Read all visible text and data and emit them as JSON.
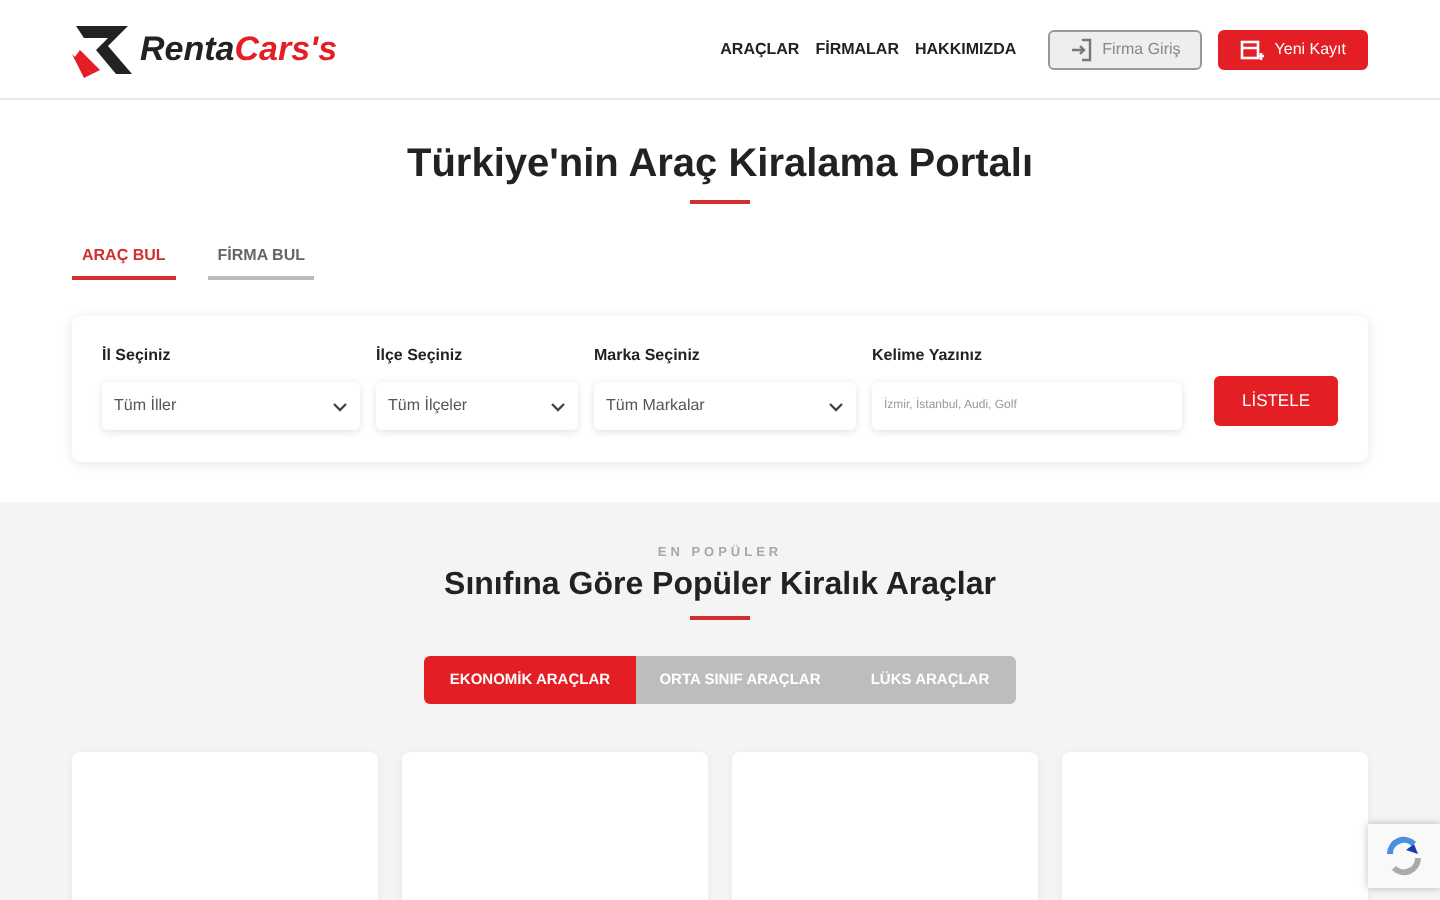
{
  "brand": {
    "name_part_1": "Renta",
    "name_part_2": "Cars's"
  },
  "nav": [
    {
      "label": "ARAÇLAR"
    },
    {
      "label": "FİRMALAR"
    },
    {
      "label": "HAKKIMIZDA"
    }
  ],
  "header_buttons": [
    {
      "kind": "outline",
      "label": "Firma Giriş"
    },
    {
      "kind": "primary",
      "label": "Yeni Kayıt"
    }
  ],
  "hero_title": "Türkiye'nin Araç Kiralama Portalı",
  "search_tabs": [
    {
      "label": "ARAÇ BUL",
      "selected": true
    },
    {
      "label": "FİRMA BUL",
      "selected": false
    }
  ],
  "search_fields": [
    {
      "kind": "select",
      "label": "İl Seçiniz",
      "value": "Tüm İller"
    },
    {
      "kind": "select",
      "label": "İlçe Seçiniz",
      "value": "Tüm İlçeler"
    },
    {
      "kind": "select",
      "label": "Marka Seçiniz",
      "value": "Tüm Markalar"
    },
    {
      "kind": "text",
      "label": "Kelime Yazınız",
      "placeholder": "İzmir, İstanbul, Audi, Golf"
    }
  ],
  "search_button": "LİSTELE",
  "popular": {
    "eyebrow": "EN POPÜLER",
    "title": "Sınıfına Göre Popüler Kiralık Araçlar",
    "tabs": [
      {
        "label": "EKONOMİK ARAÇLAR",
        "selected": true
      },
      {
        "label": "ORTA SINIF ARAÇLAR",
        "selected": false
      },
      {
        "label": "LÜKS ARAÇLAR",
        "selected": false
      }
    ],
    "cards": [
      {
        "kind": "empty"
      },
      {
        "kind": "empty"
      },
      {
        "kind": "empty"
      },
      {
        "kind": "empty"
      }
    ]
  }
}
